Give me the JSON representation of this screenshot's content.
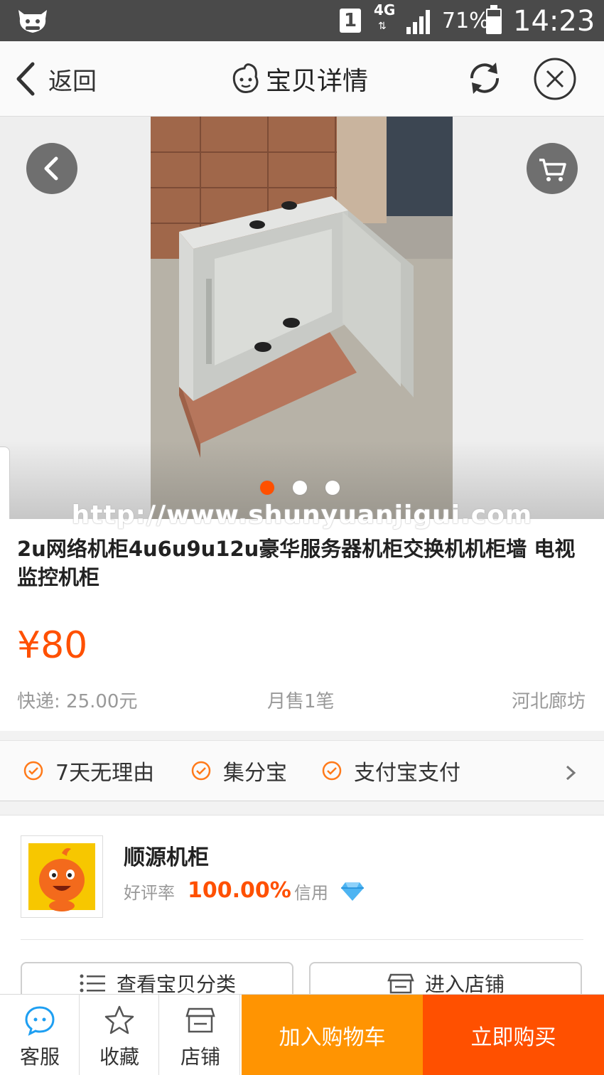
{
  "status_bar": {
    "sim_slot": "1",
    "network": "4G",
    "battery_text": "71%",
    "battery_level": 0.71,
    "time": "14:23"
  },
  "nav": {
    "back_label": "返回",
    "title": "宝贝详情",
    "icons": [
      "back-chevron-icon",
      "mascot-icon",
      "refresh-icon",
      "close-icon"
    ]
  },
  "gallery": {
    "image_count": 3,
    "active_index": 0,
    "watermark": "http://www.shunyuanjigui.com",
    "icons": [
      "back-arrow-icon",
      "cart-icon"
    ]
  },
  "product": {
    "title": "2u网络机柜4u6u9u12u豪华服务器机柜交换机机柜墙 电视 监控机柜",
    "price": "¥80",
    "shipping": "快递: 25.00元",
    "monthly_sales": "月售1笔",
    "location": "河北廊坊"
  },
  "guarantees": {
    "items": [
      "7天无理由",
      "集分宝",
      "支付宝支付"
    ]
  },
  "shop": {
    "name": "顺源机柜",
    "rating_label": "好评率",
    "rating_value": "100.00%",
    "credit_label": "信用",
    "category_button": "查看宝贝分类",
    "enter_button": "进入店铺"
  },
  "bottom_bar": {
    "customer_service": "客服",
    "favorite": "收藏",
    "store": "店铺",
    "add_to_cart": "加入购物车",
    "buy_now": "立即购买"
  },
  "colors": {
    "accent": "#ff5000",
    "cart_orange": "#ff9402",
    "status_bar": "#4a4a4a",
    "icon_blue": "#1e9ff2"
  }
}
